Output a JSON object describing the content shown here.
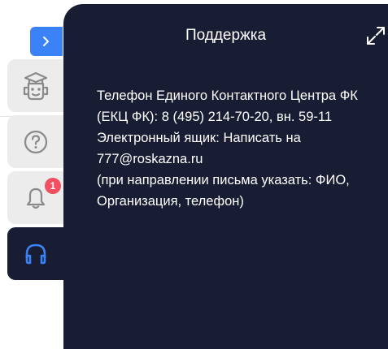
{
  "panel": {
    "title": "Поддержка",
    "content": {
      "line1": "Телефон Единого Контактного Центра ФК (ЕКЦ ФК): 8 (495) 214-70-20, вн. 59-11",
      "email_prefix": "Электронный ящик: ",
      "email_link": "Написать на 777@roskazna.ru",
      "note": "(при направлении письма указать: ФИО, Организация, телефон)"
    }
  },
  "sidebar": {
    "tabs": [
      {
        "name": "robot-assistant",
        "icon": "robot-icon"
      },
      {
        "name": "help",
        "icon": "question-icon"
      },
      {
        "name": "notifications",
        "icon": "bell-icon",
        "badge": "1"
      },
      {
        "name": "support",
        "icon": "headphones-icon",
        "active": true
      }
    ]
  },
  "colors": {
    "panel_bg": "#181d33",
    "accent": "#3b82f6",
    "badge": "#f0505f",
    "tab_bg": "#ececec"
  }
}
